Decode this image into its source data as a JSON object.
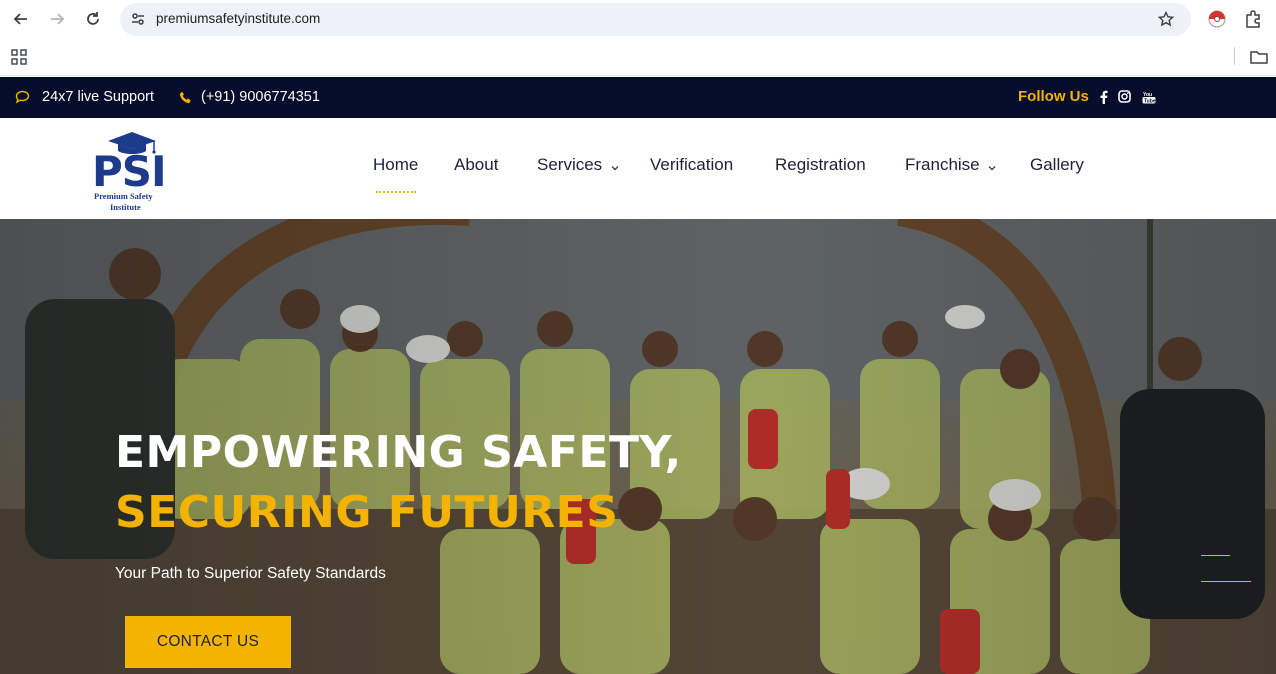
{
  "browser": {
    "url": "premiumsafetyinstitute.com"
  },
  "topbar": {
    "support_label": "24x7 live Support",
    "phone": "(+91) 9006774351",
    "follow_label": "Follow Us",
    "social_icons": [
      "facebook-icon",
      "instagram-icon",
      "youtube-icon"
    ]
  },
  "logo": {
    "letters": "PSI",
    "line1": "Premium Safety",
    "line2": "Institute"
  },
  "nav": {
    "home": "Home",
    "about": "About",
    "services": "Services",
    "verification": "Verification",
    "registration": "Registration",
    "franchise": "Franchise",
    "gallery": "Gallery",
    "dropdown_caret": "⌄",
    "active": "Home"
  },
  "hero": {
    "heading_line1": "EMPOWERING SAFETY,",
    "heading_line2": "SECURING FUTURES",
    "tagline": "Your Path to Superior Safety Standards",
    "cta_label": "CONTACT US"
  },
  "colors": {
    "accent": "#f3b300",
    "topbar_bg": "#050d2a",
    "nav_text": "#1c2238"
  }
}
